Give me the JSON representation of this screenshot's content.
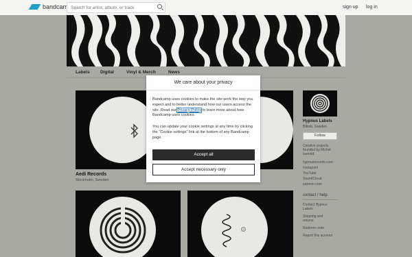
{
  "header": {
    "logo_text": "bandcamp",
    "search_placeholder": "Search for artist, album, or track",
    "signup": "sign up",
    "login": "log in"
  },
  "nav": {
    "items": [
      "Labels",
      "Digital",
      "Vinyl & Merch",
      "News"
    ]
  },
  "records": [
    {
      "title": "Aedi Records",
      "location": "Stockholm, Sweden"
    }
  ],
  "sidebar": {
    "name": "Hypnus Labels",
    "location": "Bålsta, Sweden",
    "follow": "Follow",
    "bio": [
      "Creative projects",
      "founded by Michel",
      "Isenold."
    ],
    "links": [
      "hypnusrecords.com",
      "Instagram",
      "YouTube",
      "SoundCloud",
      "patreon.com"
    ],
    "contact_heading": "contact / help",
    "contact_links": [
      "Contact Hypnus",
      "Labels"
    ],
    "shipping": [
      "Shipping and",
      "returns"
    ],
    "redeem": "Redeem code",
    "report": "Report this account"
  },
  "dialog": {
    "title": "We care about your privacy",
    "p1_before": "Bandcamp uses cookies to make the site work the way you expect and to better understand how our users access the site. Read our ",
    "p1_link": "Privacy Policy",
    "p1_after": " to learn more about how Bandcamp uses cookies.",
    "p2": "You can update your cookie settings at any time by clicking the \"Cookie settings\" link at the bottom of any Bandcamp page.",
    "accept_all": "Accept all",
    "accept_necessary": "Accept necessary only"
  },
  "colors": {
    "brand": "#1da0c3",
    "page_bg": "#a9a9a3",
    "accept_bg": "#2b2b2b"
  }
}
